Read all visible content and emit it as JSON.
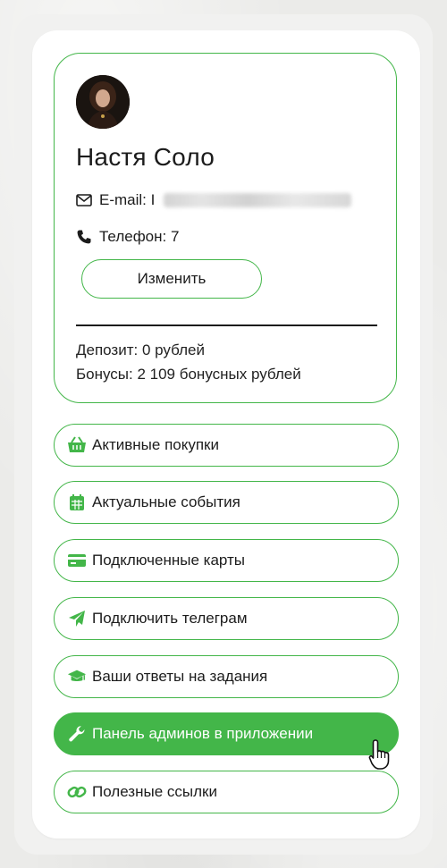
{
  "profile": {
    "name": "Настя Соло",
    "email_label": "E-mail: I",
    "phone_label": "Телефон: 7",
    "edit_button": "Изменить",
    "deposit": "Депозит: 0 рублей",
    "bonuses": "Бонусы: 2 109 бонусных рублей"
  },
  "menu": [
    {
      "label": "Активные покупки",
      "icon": "basket-icon"
    },
    {
      "label": "Актуальные события",
      "icon": "calendar-icon"
    },
    {
      "label": "Подключенные карты",
      "icon": "credit-card-icon"
    },
    {
      "label": "Подключить телеграм",
      "icon": "paper-plane-icon"
    },
    {
      "label": "Ваши ответы на задания",
      "icon": "graduation-cap-icon"
    },
    {
      "label": "Панель админов в приложении",
      "icon": "wrench-icon",
      "active": true
    },
    {
      "label": "Полезные ссылки",
      "icon": "link-icon"
    }
  ],
  "colors": {
    "accent": "#43b649",
    "text": "#1c1c1c",
    "panel": "#ffffff",
    "background": "#ebebe9"
  }
}
